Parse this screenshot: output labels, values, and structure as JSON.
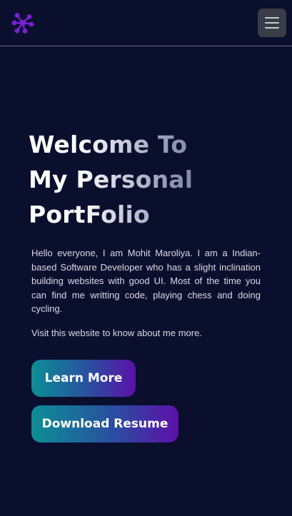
{
  "header": {
    "logo_icon": "purple-molecule-logo-icon",
    "menu_icon": "hamburger-menu-icon",
    "accent_color": "#7a1fd6"
  },
  "hero": {
    "title_lines": [
      "Welcome To",
      "My Personal",
      "PortFolio"
    ],
    "description": "Hello everyone, I am Mohit Maroliya. I am a Indian-based Software Developer who has a slight inclination building websites with good UI. Most of the time you can find me writting code, playing chess and doing cycling.",
    "visit_text": "Visit this website to know about me more."
  },
  "buttons": {
    "learn_more": "Learn More",
    "download_resume": "Download Resume"
  },
  "colors": {
    "background": "#0b0f2e",
    "button_gradient_start": "#0b8f95",
    "button_gradient_end": "#5b10a8"
  }
}
